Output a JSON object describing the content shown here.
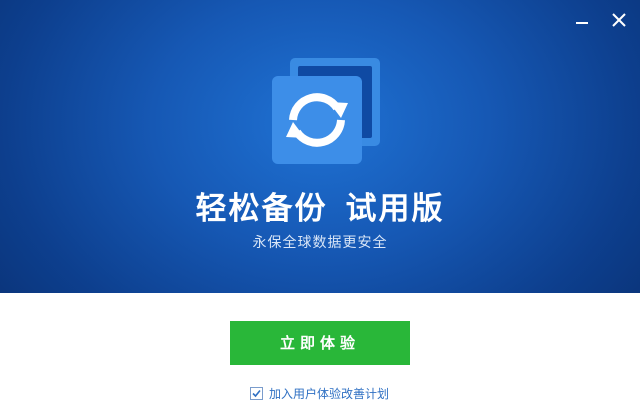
{
  "window": {
    "minimize_icon": "minimize-icon",
    "close_icon": "close-icon",
    "close_glyph": "✕"
  },
  "header": {
    "title_main": "轻松备份",
    "title_edition": "试用版",
    "subtitle": "永保全球数据更安全",
    "app_icon": "sync-icon",
    "accent_color": "#1658b4"
  },
  "actions": {
    "primary_label": "立即体验",
    "primary_color": "#29b739"
  },
  "consent": {
    "label": "加入用户体验改善计划",
    "checked": true
  }
}
